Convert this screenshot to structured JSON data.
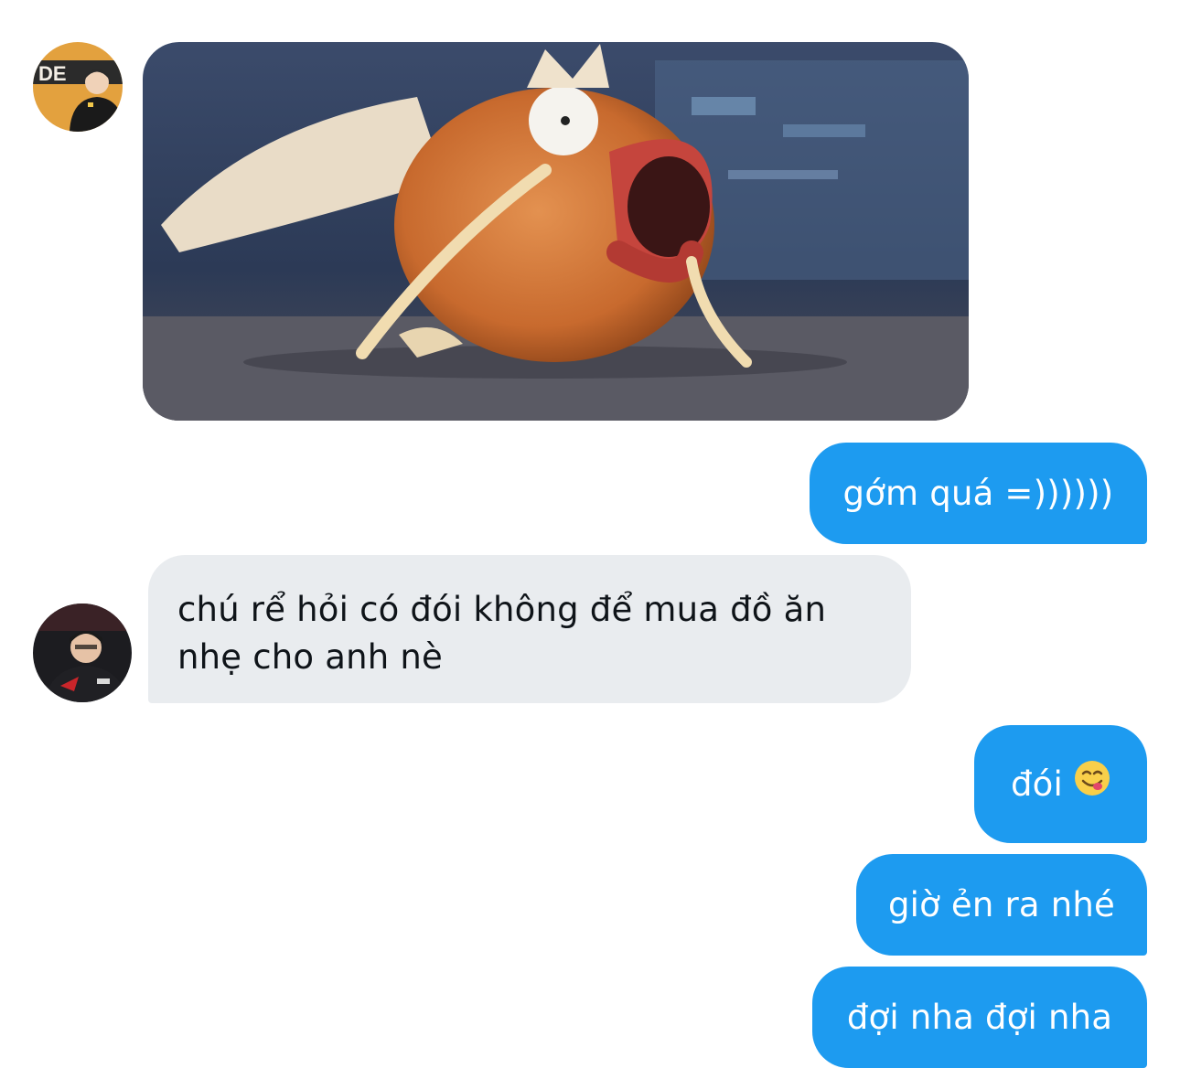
{
  "conversation": {
    "messages": [
      {
        "direction": "incoming",
        "type": "image",
        "image": "magikarp-meme-photo"
      },
      {
        "direction": "outgoing",
        "text": "gớm quá =))))))"
      },
      {
        "direction": "incoming",
        "text": "chú rể hỏi có đói không để mua đồ ăn nhẹ cho anh nè"
      },
      {
        "direction": "outgoing",
        "text": "đói",
        "emoji": "face-savoring-food-emoji"
      },
      {
        "direction": "outgoing",
        "text": "giờ ẻn ra nhé"
      },
      {
        "direction": "outgoing",
        "text": "đợi nha đợi nha"
      }
    ]
  },
  "avatars": {
    "top": "user-avatar-photo",
    "bottom": "contact-avatar-photo"
  },
  "colors": {
    "outgoing_bubble": "#1d9bf0",
    "incoming_bubble": "#e9ecef",
    "incoming_text": "#0f1419",
    "outgoing_text": "#ffffff"
  }
}
